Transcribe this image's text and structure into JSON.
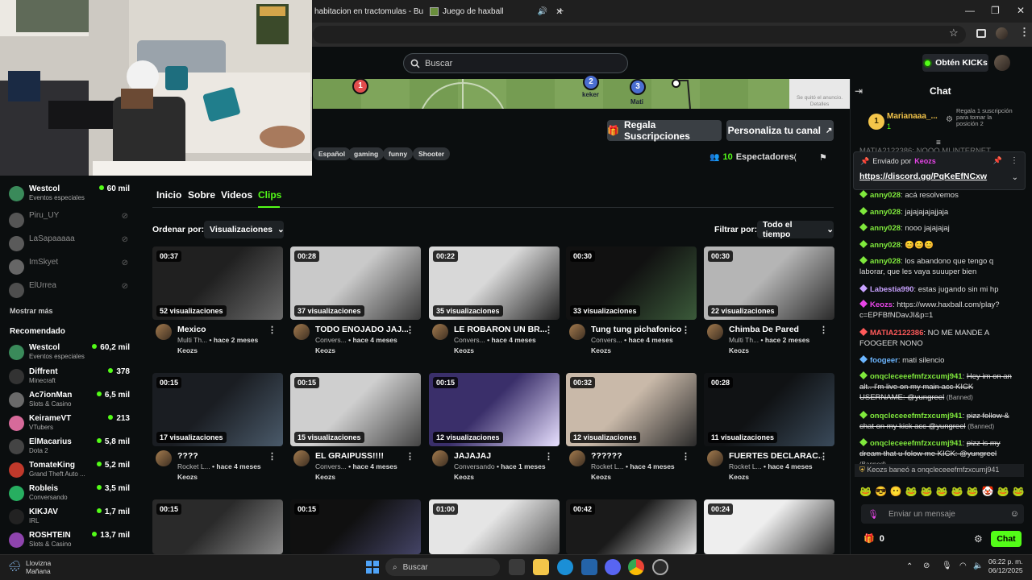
{
  "browser": {
    "tabs": [
      {
        "label": "habitacion en tractomulas - Bu"
      },
      {
        "label": "Juego de haxball"
      }
    ]
  },
  "header": {
    "search_placeholder": "Buscar",
    "kicks_button": "Obtén KICKs"
  },
  "banner": {
    "players": [
      {
        "number": "1",
        "name": ""
      },
      {
        "number": "2",
        "name": "keker"
      },
      {
        "number": "3",
        "name": "Mati"
      }
    ],
    "ad_text": "Se quitó el anuncio. Detalles"
  },
  "channel": {
    "gift_button": "Regala Suscripciones",
    "customize_button": "Personaliza tu canal",
    "tags": [
      "Español",
      "gaming",
      "funny",
      "Shooter"
    ],
    "viewers_count": "10",
    "viewers_label": "Espectadores",
    "tabs": [
      "Inicio",
      "Sobre",
      "Videos",
      "Clips"
    ],
    "active_tab": "Clips",
    "sort_label": "Ordenar por:",
    "sort_value": "Visualizaciones",
    "filter_label": "Filtrar por:",
    "filter_value": "Todo el tiempo"
  },
  "sidebar": {
    "following": [
      {
        "name": "Westcol",
        "category": "Eventos especiales",
        "viewers": "60 mil",
        "live": true
      },
      {
        "name": "Piru_UY",
        "live": false
      },
      {
        "name": "LaSapaaaaa",
        "live": false
      },
      {
        "name": "ImSkyet",
        "live": false
      },
      {
        "name": "ElUrrea",
        "live": false
      }
    ],
    "show_more": "Mostrar más",
    "recommended_title": "Recomendado",
    "recommended": [
      {
        "name": "Westcol",
        "category": "Eventos especiales",
        "viewers": "60,2 mil"
      },
      {
        "name": "Diffrent",
        "category": "Minecraft",
        "viewers": "378"
      },
      {
        "name": "Ac7ionMan",
        "category": "Slots & Casino",
        "viewers": "6,5 mil"
      },
      {
        "name": "KeirameVT",
        "category": "VTubers",
        "viewers": "213"
      },
      {
        "name": "ElMacarius",
        "category": "Dota 2",
        "viewers": "5,8 mil"
      },
      {
        "name": "TomateKing",
        "category": "Grand Theft Auto ...",
        "viewers": "5,2 mil"
      },
      {
        "name": "Robleis",
        "category": "Conversando",
        "viewers": "3,5 mil"
      },
      {
        "name": "KIKJAV",
        "category": "IRL",
        "viewers": "1,7 mil"
      },
      {
        "name": "ROSHTEIN",
        "category": "Slots & Casino",
        "viewers": "13,7 mil"
      }
    ]
  },
  "clips": [
    {
      "duration": "00:37",
      "views": "52 visualizaciones",
      "title": "Mexico",
      "category": "Multi Th...",
      "age": "• hace 2 meses",
      "author": "Keozs"
    },
    {
      "duration": "00:28",
      "views": "37 visualizaciones",
      "title": "TODO ENOJADO JAJ...",
      "category": "Convers...",
      "age": "• hace 4 meses",
      "author": "Keozs"
    },
    {
      "duration": "00:22",
      "views": "35 visualizaciones",
      "title": "LE ROBARON UN BR...",
      "category": "Convers...",
      "age": "• hace 4 meses",
      "author": "Keozs"
    },
    {
      "duration": "00:30",
      "views": "33 visualizaciones",
      "title": "Tung tung pichafonico",
      "category": "Convers...",
      "age": "• hace 4 meses",
      "author": "Keozs"
    },
    {
      "duration": "00:30",
      "views": "22 visualizaciones",
      "title": "Chimba De Pared",
      "category": "Multi Th...",
      "age": "• hace 2 meses",
      "author": "Keozs"
    },
    {
      "duration": "00:15",
      "views": "17 visualizaciones",
      "title": "????",
      "category": "Rocket L...",
      "age": "• hace 4 meses",
      "author": "Keozs"
    },
    {
      "duration": "00:15",
      "views": "15 visualizaciones",
      "title": "EL GRAIPUSS!!!!",
      "category": "Convers...",
      "age": "• hace 4 meses",
      "author": "Keozs"
    },
    {
      "duration": "00:15",
      "views": "12 visualizaciones",
      "title": "JAJAJAJ",
      "category": "Conversando",
      "age": "• hace 1 meses",
      "author": "Keozs"
    },
    {
      "duration": "00:32",
      "views": "12 visualizaciones",
      "title": "??????",
      "category": "Rocket L...",
      "age": "• hace 4 meses",
      "author": "Keozs"
    },
    {
      "duration": "00:28",
      "views": "11 visualizaciones",
      "title": "FUERTES DECLARAC...",
      "category": "Rocket L...",
      "age": "• hace 4 meses",
      "author": "Keozs"
    },
    {
      "duration": "00:15"
    },
    {
      "duration": "00:15"
    },
    {
      "duration": "01:00"
    },
    {
      "duration": "00:42"
    },
    {
      "duration": "00:24"
    }
  ],
  "chat": {
    "title": "Chat",
    "top_gifter": {
      "rank": "1",
      "name": "Marianaaa_...",
      "count": "1"
    },
    "goal_text": "Regala 1 suscripción para tomar la posición 2",
    "pinned_by_label": "Enviado por",
    "pinned_by_user": "Keozs",
    "pinned_link": "https://discord.gg/PqKeEfNCxw",
    "obscured_line": "MATIA2122386: NOOO MI INTERNET",
    "messages": [
      {
        "user": "anny028",
        "text": "acá resolvemos",
        "color": "#7fe83c"
      },
      {
        "user": "anny028",
        "text": "jajajajajajjaja",
        "color": "#7fe83c"
      },
      {
        "user": "anny028",
        "text": "nooo jajajajaj",
        "color": "#7fe83c"
      },
      {
        "user": "anny028",
        "text": "😊😊😊",
        "color": "#7fe83c"
      },
      {
        "user": "anny028",
        "text": "los abandono que tengo q laborar, que les vaya suuuper bien",
        "color": "#7fe83c"
      },
      {
        "user": "Labestia990",
        "text": "estas jugando sin mi hp",
        "color": "#c8a2ff"
      },
      {
        "user": "Keozs",
        "text": "https://www.haxball.com/play?c=EPFBfNDavJI&p=1",
        "color": "#e845e8"
      },
      {
        "user": "MATIA2122386",
        "text": "NO ME MANDE A FOOGEER NONO",
        "color": "#ff5a5a"
      },
      {
        "user": "foogeer",
        "text": "mati silencio",
        "color": "#6cb6ff"
      },
      {
        "user": "onqcleceeefmfzxcumj941",
        "text": "Hey im on an alt.. I'm live on my main acc KICK USERNAME: @yungreel",
        "color": "#7fe83c",
        "banned": true
      },
      {
        "user": "onqcleceeefmfzxcumj941",
        "text": "pizz follow & chat on my kick acc @yungreel",
        "color": "#7fe83c",
        "banned": true
      },
      {
        "user": "onqcleceeefmfzxcumj941",
        "text": "pizz is my dream that u folow me KICK: @yungreel",
        "color": "#7fe83c",
        "banned": true
      }
    ],
    "banned_tag": "(Banned)",
    "ban_notice": "Keozs baneó a onqcleceeefmfzxcumj941",
    "emotes": [
      "🐸",
      "😎",
      "😶",
      "🐸",
      "🐸",
      "🐸",
      "🐸",
      "🐸",
      "🤡",
      "🐸",
      "🐸"
    ],
    "input_placeholder": "Enviar un mensaje",
    "kicks_count": "0",
    "send_button": "Chat"
  },
  "taskbar": {
    "weather_line1": "Llovizna",
    "weather_line2": "Mañana",
    "search_placeholder": "Buscar",
    "time": "06:22 p. m.",
    "date": "06/12/2025"
  }
}
